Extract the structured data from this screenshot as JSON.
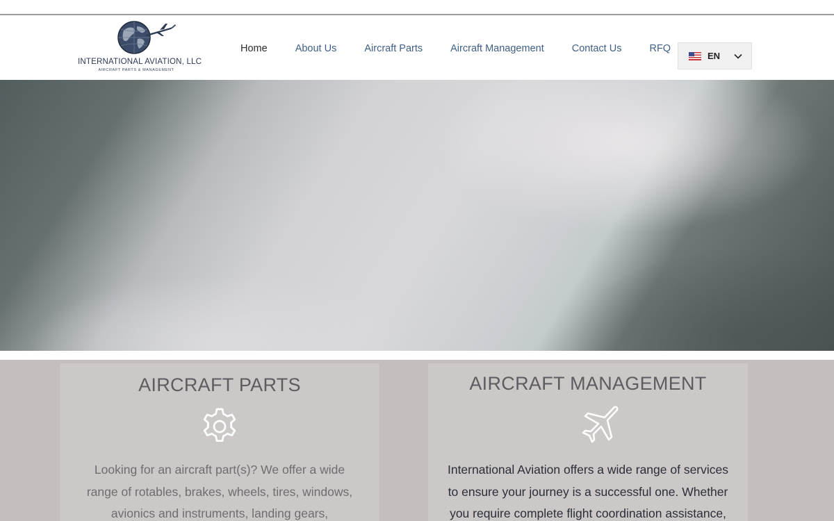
{
  "header": {
    "logo": {
      "title": "INTERNATIONAL AVIATION, LLC",
      "subtitle": "AIRCRAFT PARTS & MANAGEMENT"
    },
    "nav": [
      {
        "label": "Home",
        "active": true
      },
      {
        "label": "About Us",
        "active": false
      },
      {
        "label": "Aircraft Parts",
        "active": false
      },
      {
        "label": "Aircraft Management",
        "active": false
      },
      {
        "label": "Contact Us",
        "active": false
      },
      {
        "label": "RFQ",
        "active": false
      }
    ],
    "language": {
      "label": "EN",
      "flag": "us-flag-icon"
    }
  },
  "cards": {
    "parts": {
      "title": "AIRCRAFT PARTS",
      "icon": "gear-icon",
      "lines": [
        "Looking for an aircraft part(s)? We offer a wide",
        "range of rotables, brakes, wheels, tires, windows,",
        "avionics and instruments, landing gears,"
      ]
    },
    "management": {
      "title": "AIRCRAFT MANAGEMENT",
      "icon": "airplane-icon",
      "lines": [
        "International Aviation offers a wide range of services",
        "to ensure your journey is a successful one. Whether",
        "you require complete flight coordination assistance,"
      ]
    }
  },
  "colors": {
    "nav_link": "#3f5f86",
    "nav_active": "#2c2c2c",
    "section_bg": "#c4bebd",
    "card_bg": "#ccc8c7",
    "card_title": "#5d5c60"
  }
}
